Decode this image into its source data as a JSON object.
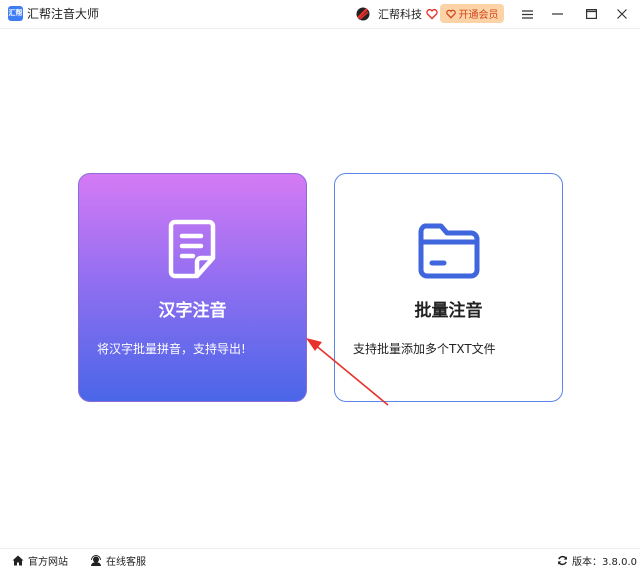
{
  "window": {
    "logo_text": "汇帮",
    "title": "汇帮注音大师",
    "brand_name": "汇帮科技",
    "vip_label": "开通会员"
  },
  "cards": [
    {
      "title": "汉字注音",
      "description": "将汉字批量拼音，支持导出!",
      "icon": "document-icon"
    },
    {
      "title": "批量注音",
      "description": "支持批量添加多个TXT文件",
      "icon": "folder-icon"
    }
  ],
  "footer": {
    "website": "官方网站",
    "support": "在线客服",
    "version": "版本：3.8.0.0"
  },
  "colors": {
    "accent": "#3d7df5",
    "card_gradient_top": "#d57af5",
    "card_gradient_bottom": "#4a66e8",
    "vip_bg": "#fbd3a6",
    "vip_text": "#d2461e",
    "annotation_arrow": "#e8312a"
  }
}
